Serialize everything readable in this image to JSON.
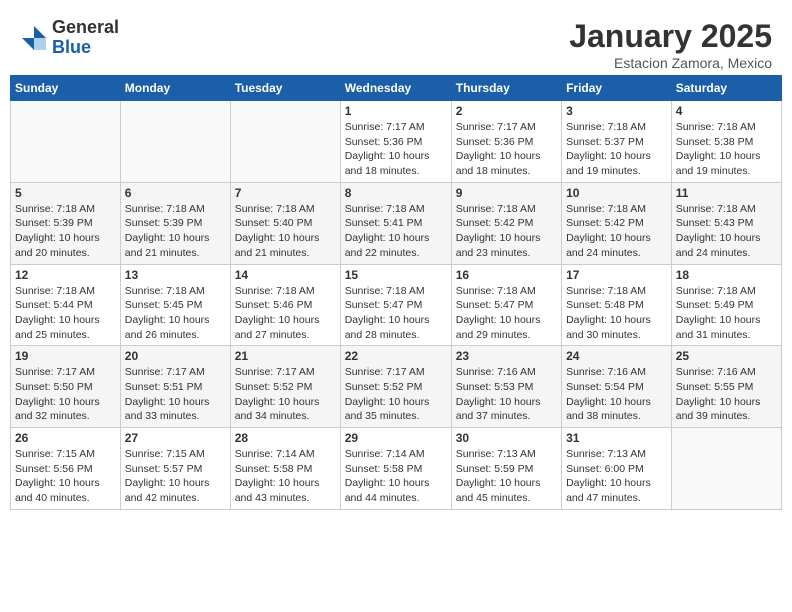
{
  "header": {
    "logo_general": "General",
    "logo_blue": "Blue",
    "title": "January 2025",
    "subtitle": "Estacion Zamora, Mexico"
  },
  "weekdays": [
    "Sunday",
    "Monday",
    "Tuesday",
    "Wednesday",
    "Thursday",
    "Friday",
    "Saturday"
  ],
  "weeks": [
    [
      {
        "day": "",
        "info": ""
      },
      {
        "day": "",
        "info": ""
      },
      {
        "day": "",
        "info": ""
      },
      {
        "day": "1",
        "info": "Sunrise: 7:17 AM\nSunset: 5:36 PM\nDaylight: 10 hours\nand 18 minutes."
      },
      {
        "day": "2",
        "info": "Sunrise: 7:17 AM\nSunset: 5:36 PM\nDaylight: 10 hours\nand 18 minutes."
      },
      {
        "day": "3",
        "info": "Sunrise: 7:18 AM\nSunset: 5:37 PM\nDaylight: 10 hours\nand 19 minutes."
      },
      {
        "day": "4",
        "info": "Sunrise: 7:18 AM\nSunset: 5:38 PM\nDaylight: 10 hours\nand 19 minutes."
      }
    ],
    [
      {
        "day": "5",
        "info": "Sunrise: 7:18 AM\nSunset: 5:39 PM\nDaylight: 10 hours\nand 20 minutes."
      },
      {
        "day": "6",
        "info": "Sunrise: 7:18 AM\nSunset: 5:39 PM\nDaylight: 10 hours\nand 21 minutes."
      },
      {
        "day": "7",
        "info": "Sunrise: 7:18 AM\nSunset: 5:40 PM\nDaylight: 10 hours\nand 21 minutes."
      },
      {
        "day": "8",
        "info": "Sunrise: 7:18 AM\nSunset: 5:41 PM\nDaylight: 10 hours\nand 22 minutes."
      },
      {
        "day": "9",
        "info": "Sunrise: 7:18 AM\nSunset: 5:42 PM\nDaylight: 10 hours\nand 23 minutes."
      },
      {
        "day": "10",
        "info": "Sunrise: 7:18 AM\nSunset: 5:42 PM\nDaylight: 10 hours\nand 24 minutes."
      },
      {
        "day": "11",
        "info": "Sunrise: 7:18 AM\nSunset: 5:43 PM\nDaylight: 10 hours\nand 24 minutes."
      }
    ],
    [
      {
        "day": "12",
        "info": "Sunrise: 7:18 AM\nSunset: 5:44 PM\nDaylight: 10 hours\nand 25 minutes."
      },
      {
        "day": "13",
        "info": "Sunrise: 7:18 AM\nSunset: 5:45 PM\nDaylight: 10 hours\nand 26 minutes."
      },
      {
        "day": "14",
        "info": "Sunrise: 7:18 AM\nSunset: 5:46 PM\nDaylight: 10 hours\nand 27 minutes."
      },
      {
        "day": "15",
        "info": "Sunrise: 7:18 AM\nSunset: 5:47 PM\nDaylight: 10 hours\nand 28 minutes."
      },
      {
        "day": "16",
        "info": "Sunrise: 7:18 AM\nSunset: 5:47 PM\nDaylight: 10 hours\nand 29 minutes."
      },
      {
        "day": "17",
        "info": "Sunrise: 7:18 AM\nSunset: 5:48 PM\nDaylight: 10 hours\nand 30 minutes."
      },
      {
        "day": "18",
        "info": "Sunrise: 7:18 AM\nSunset: 5:49 PM\nDaylight: 10 hours\nand 31 minutes."
      }
    ],
    [
      {
        "day": "19",
        "info": "Sunrise: 7:17 AM\nSunset: 5:50 PM\nDaylight: 10 hours\nand 32 minutes."
      },
      {
        "day": "20",
        "info": "Sunrise: 7:17 AM\nSunset: 5:51 PM\nDaylight: 10 hours\nand 33 minutes."
      },
      {
        "day": "21",
        "info": "Sunrise: 7:17 AM\nSunset: 5:52 PM\nDaylight: 10 hours\nand 34 minutes."
      },
      {
        "day": "22",
        "info": "Sunrise: 7:17 AM\nSunset: 5:52 PM\nDaylight: 10 hours\nand 35 minutes."
      },
      {
        "day": "23",
        "info": "Sunrise: 7:16 AM\nSunset: 5:53 PM\nDaylight: 10 hours\nand 37 minutes."
      },
      {
        "day": "24",
        "info": "Sunrise: 7:16 AM\nSunset: 5:54 PM\nDaylight: 10 hours\nand 38 minutes."
      },
      {
        "day": "25",
        "info": "Sunrise: 7:16 AM\nSunset: 5:55 PM\nDaylight: 10 hours\nand 39 minutes."
      }
    ],
    [
      {
        "day": "26",
        "info": "Sunrise: 7:15 AM\nSunset: 5:56 PM\nDaylight: 10 hours\nand 40 minutes."
      },
      {
        "day": "27",
        "info": "Sunrise: 7:15 AM\nSunset: 5:57 PM\nDaylight: 10 hours\nand 42 minutes."
      },
      {
        "day": "28",
        "info": "Sunrise: 7:14 AM\nSunset: 5:58 PM\nDaylight: 10 hours\nand 43 minutes."
      },
      {
        "day": "29",
        "info": "Sunrise: 7:14 AM\nSunset: 5:58 PM\nDaylight: 10 hours\nand 44 minutes."
      },
      {
        "day": "30",
        "info": "Sunrise: 7:13 AM\nSunset: 5:59 PM\nDaylight: 10 hours\nand 45 minutes."
      },
      {
        "day": "31",
        "info": "Sunrise: 7:13 AM\nSunset: 6:00 PM\nDaylight: 10 hours\nand 47 minutes."
      },
      {
        "day": "",
        "info": ""
      }
    ]
  ]
}
